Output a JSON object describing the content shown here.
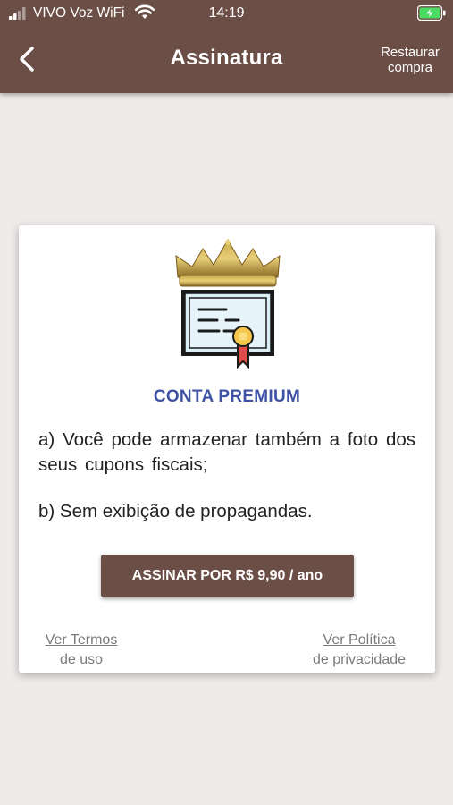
{
  "status_bar": {
    "carrier": "VIVO Voz WiFi",
    "time": "14:19"
  },
  "header": {
    "title": "Assinatura",
    "restore_line1": "Restaurar",
    "restore_line2": "compra",
    "color": "#6b4e45"
  },
  "card": {
    "title": "CONTA PREMIUM",
    "benefit_a": "a) Você pode armazenar também a foto dos seus cupons fiscais;",
    "benefit_b": "b) Sem exibição de propagandas.",
    "subscribe_label": "ASSINAR POR R$ 9,90 / ano",
    "terms_line1": "Ver Termos",
    "terms_line2": "de uso",
    "privacy_line1": "Ver Política",
    "privacy_line2": "de privacidade",
    "title_color": "#3f52a3"
  },
  "icons": [
    "signal-icon",
    "wifi-icon",
    "battery-charging-icon",
    "back-chevron-icon",
    "crown-certificate-icon"
  ]
}
